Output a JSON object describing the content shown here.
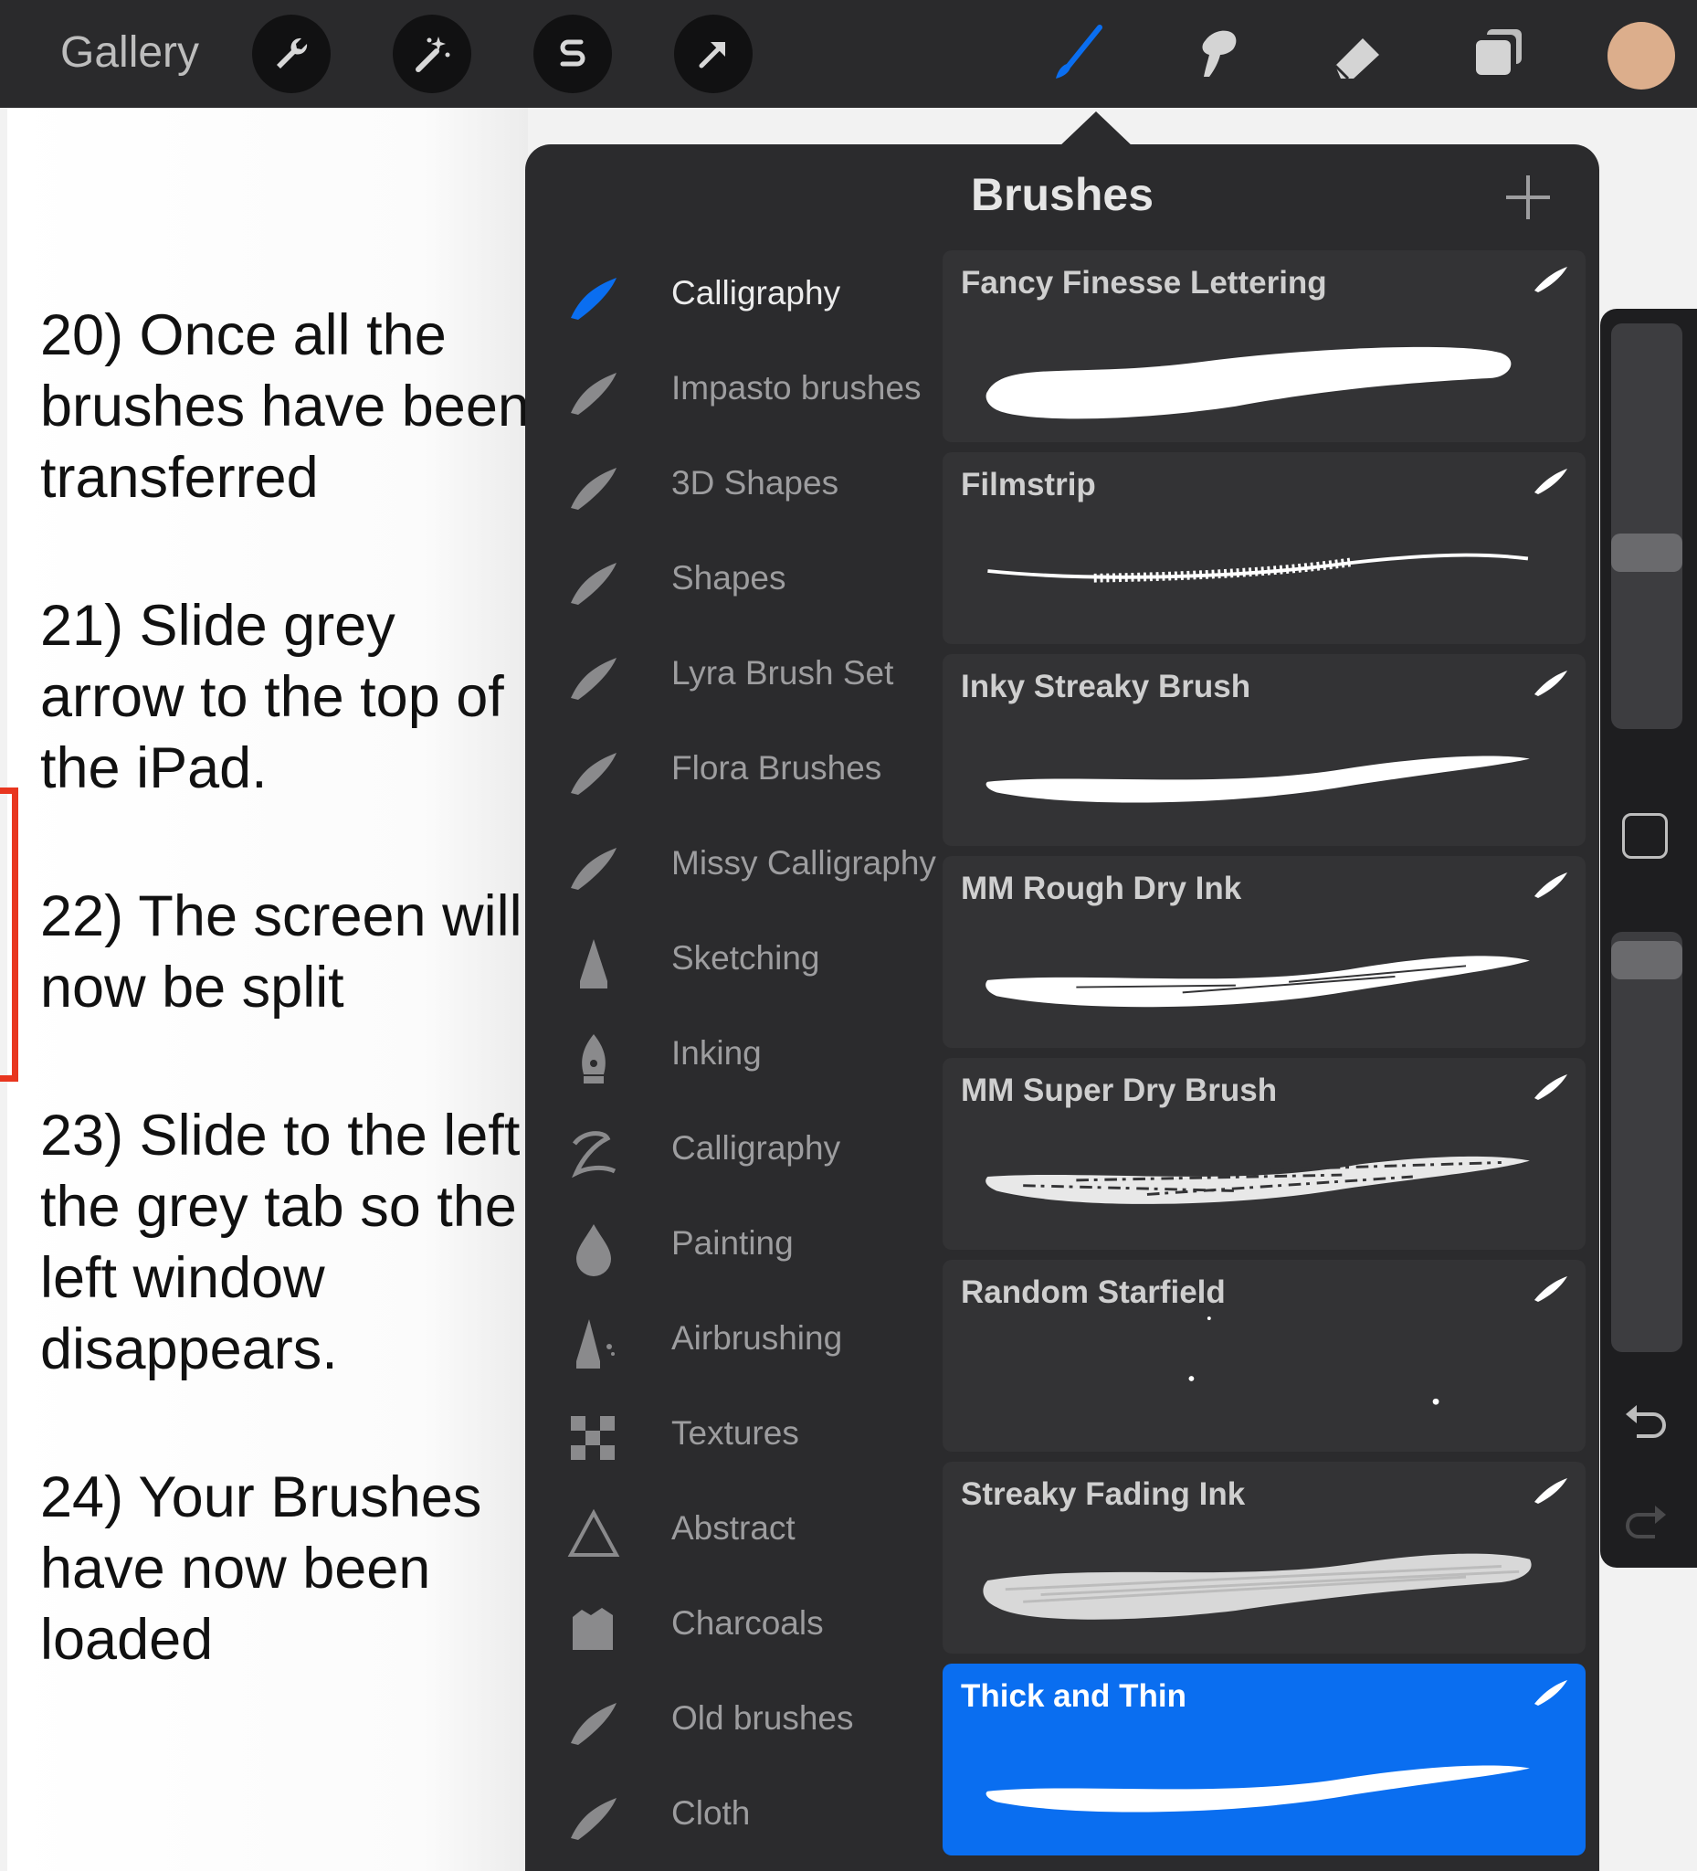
{
  "toolbar": {
    "gallery_label": "Gallery",
    "left_tools": [
      "wrench-icon",
      "magic-wand-icon",
      "selection-s-icon",
      "transform-arrow-icon"
    ],
    "right_tools": [
      "brush-icon",
      "smudge-icon",
      "eraser-icon",
      "layers-icon"
    ],
    "active_tool": "brush-icon",
    "accent": "#0a6ef0",
    "current_color": "#dcae8c"
  },
  "instructions": [
    "20) Once all the brushes have been transferred",
    "21) Slide grey arrow to the top of the iPad.",
    "22) The screen will now be split",
    "23) Slide to the left the grey tab so the left window disappears.",
    "24) Your Brushes have now been loaded"
  ],
  "panel": {
    "title": "Brushes",
    "brush_sets": [
      {
        "label": "Calligraphy",
        "icon": "stroke-icon",
        "active": true
      },
      {
        "label": "Impasto brushes",
        "icon": "stroke-icon"
      },
      {
        "label": "3D Shapes",
        "icon": "stroke-icon"
      },
      {
        "label": "Shapes",
        "icon": "stroke-icon"
      },
      {
        "label": "Lyra Brush Set",
        "icon": "stroke-icon"
      },
      {
        "label": "Flora Brushes",
        "icon": "stroke-icon"
      },
      {
        "label": "Missy Calligraphy",
        "icon": "stroke-icon"
      },
      {
        "label": "Sketching",
        "icon": "pencil-tip-icon"
      },
      {
        "label": "Inking",
        "icon": "pen-nib-icon"
      },
      {
        "label": "Calligraphy",
        "icon": "calligraphy-z-icon"
      },
      {
        "label": "Painting",
        "icon": "paint-drop-icon"
      },
      {
        "label": "Airbrushing",
        "icon": "airbrush-icon"
      },
      {
        "label": "Textures",
        "icon": "checker-texture-icon"
      },
      {
        "label": "Abstract",
        "icon": "triangle-icon"
      },
      {
        "label": "Charcoals",
        "icon": "charcoal-icon"
      },
      {
        "label": "Old brushes",
        "icon": "stroke-icon"
      },
      {
        "label": "Cloth",
        "icon": "stroke-icon"
      }
    ],
    "brushes": [
      {
        "name": "Fancy Finesse Lettering",
        "stroke": "thick-swoosh"
      },
      {
        "name": "Filmstrip",
        "stroke": "thin-filmstrip"
      },
      {
        "name": "Inky Streaky Brush",
        "stroke": "tapered-swoosh"
      },
      {
        "name": "MM Rough Dry Ink",
        "stroke": "rough-swoosh"
      },
      {
        "name": "MM Super Dry Brush",
        "stroke": "dry-swoosh"
      },
      {
        "name": "Random Starfield",
        "stroke": "stars"
      },
      {
        "name": "Streaky Fading Ink",
        "stroke": "wide-streak"
      },
      {
        "name": "Thick and Thin",
        "stroke": "tapered-swoosh",
        "selected": true
      }
    ]
  }
}
